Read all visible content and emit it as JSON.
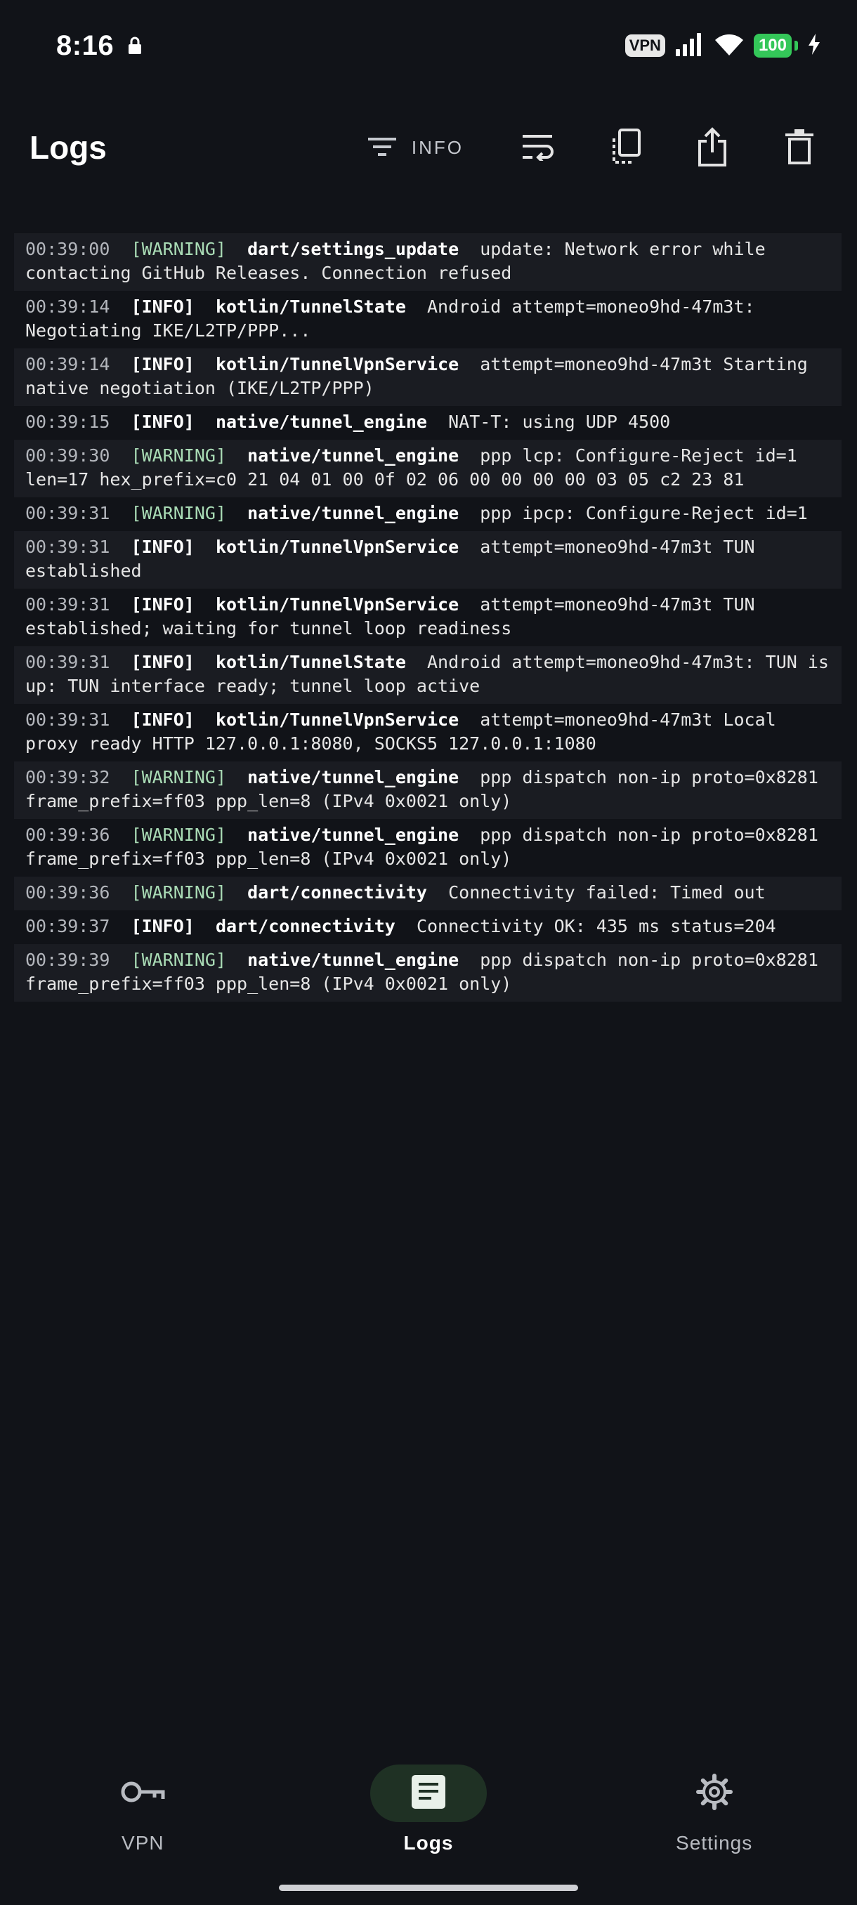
{
  "status_bar": {
    "time": "8:16",
    "vpn_badge": "VPN",
    "battery_level": "100",
    "icons": [
      "lock-icon",
      "signal-icon",
      "wifi-icon",
      "battery-icon",
      "charging-icon"
    ]
  },
  "header": {
    "title": "Logs",
    "filter_label": "INFO",
    "action_icons": [
      "filter-icon",
      "wrap-text-icon",
      "copy-icon",
      "share-icon",
      "delete-icon"
    ]
  },
  "logs": [
    {
      "ts": "00:39:00",
      "level": "[WARNING]",
      "source": "dart/settings_update",
      "message": "update: Network error while contacting GitHub Releases. Connection refused"
    },
    {
      "ts": "00:39:14",
      "level": "[INFO]",
      "source": "kotlin/TunnelState",
      "message": "Android attempt=moneo9hd-47m3t: Negotiating IKE/L2TP/PPP..."
    },
    {
      "ts": "00:39:14",
      "level": "[INFO]",
      "source": "kotlin/TunnelVpnService",
      "message": "attempt=moneo9hd-47m3t Starting native negotiation (IKE/L2TP/PPP)"
    },
    {
      "ts": "00:39:15",
      "level": "[INFO]",
      "source": "native/tunnel_engine",
      "message": "NAT-T: using UDP 4500"
    },
    {
      "ts": "00:39:30",
      "level": "[WARNING]",
      "source": "native/tunnel_engine",
      "message": "ppp lcp: Configure-Reject id=1 len=17 hex_prefix=c0 21 04 01 00 0f 02 06 00 00 00 00 03 05 c2 23 81"
    },
    {
      "ts": "00:39:31",
      "level": "[WARNING]",
      "source": "native/tunnel_engine",
      "message": "ppp ipcp: Configure-Reject id=1"
    },
    {
      "ts": "00:39:31",
      "level": "[INFO]",
      "source": "kotlin/TunnelVpnService",
      "message": "attempt=moneo9hd-47m3t TUN established"
    },
    {
      "ts": "00:39:31",
      "level": "[INFO]",
      "source": "kotlin/TunnelVpnService",
      "message": "attempt=moneo9hd-47m3t TUN established; waiting for tunnel loop readiness"
    },
    {
      "ts": "00:39:31",
      "level": "[INFO]",
      "source": "kotlin/TunnelState",
      "message": "Android attempt=moneo9hd-47m3t: TUN is up: TUN interface ready; tunnel loop active"
    },
    {
      "ts": "00:39:31",
      "level": "[INFO]",
      "source": "kotlin/TunnelVpnService",
      "message": "attempt=moneo9hd-47m3t Local proxy ready HTTP 127.0.0.1:8080, SOCKS5 127.0.0.1:1080"
    },
    {
      "ts": "00:39:32",
      "level": "[WARNING]",
      "source": "native/tunnel_engine",
      "message": "ppp dispatch non-ip proto=0x8281 frame_prefix=ff03 ppp_len=8 (IPv4 0x0021 only)"
    },
    {
      "ts": "00:39:36",
      "level": "[WARNING]",
      "source": "native/tunnel_engine",
      "message": "ppp dispatch non-ip proto=0x8281 frame_prefix=ff03 ppp_len=8 (IPv4 0x0021 only)"
    },
    {
      "ts": "00:39:36",
      "level": "[WARNING]",
      "source": "dart/connectivity",
      "message": "Connectivity failed: Timed out"
    },
    {
      "ts": "00:39:37",
      "level": "[INFO]",
      "source": "dart/connectivity",
      "message": "Connectivity OK: 435 ms status=204"
    },
    {
      "ts": "00:39:39",
      "level": "[WARNING]",
      "source": "native/tunnel_engine",
      "message": "ppp dispatch non-ip proto=0x8281 frame_prefix=ff03 ppp_len=8 (IPv4 0x0021 only)"
    }
  ],
  "nav": {
    "items": [
      {
        "label": "VPN",
        "icon": "key-icon",
        "active": false
      },
      {
        "label": "Logs",
        "icon": "article-icon",
        "active": true
      },
      {
        "label": "Settings",
        "icon": "gear-icon",
        "active": false
      }
    ]
  },
  "colors": {
    "background": "#111318",
    "row_alt": "#1a1c22",
    "warning_level": "#a9dbb5",
    "nav_active_pill": "#1f3124",
    "battery": "#34c759"
  }
}
